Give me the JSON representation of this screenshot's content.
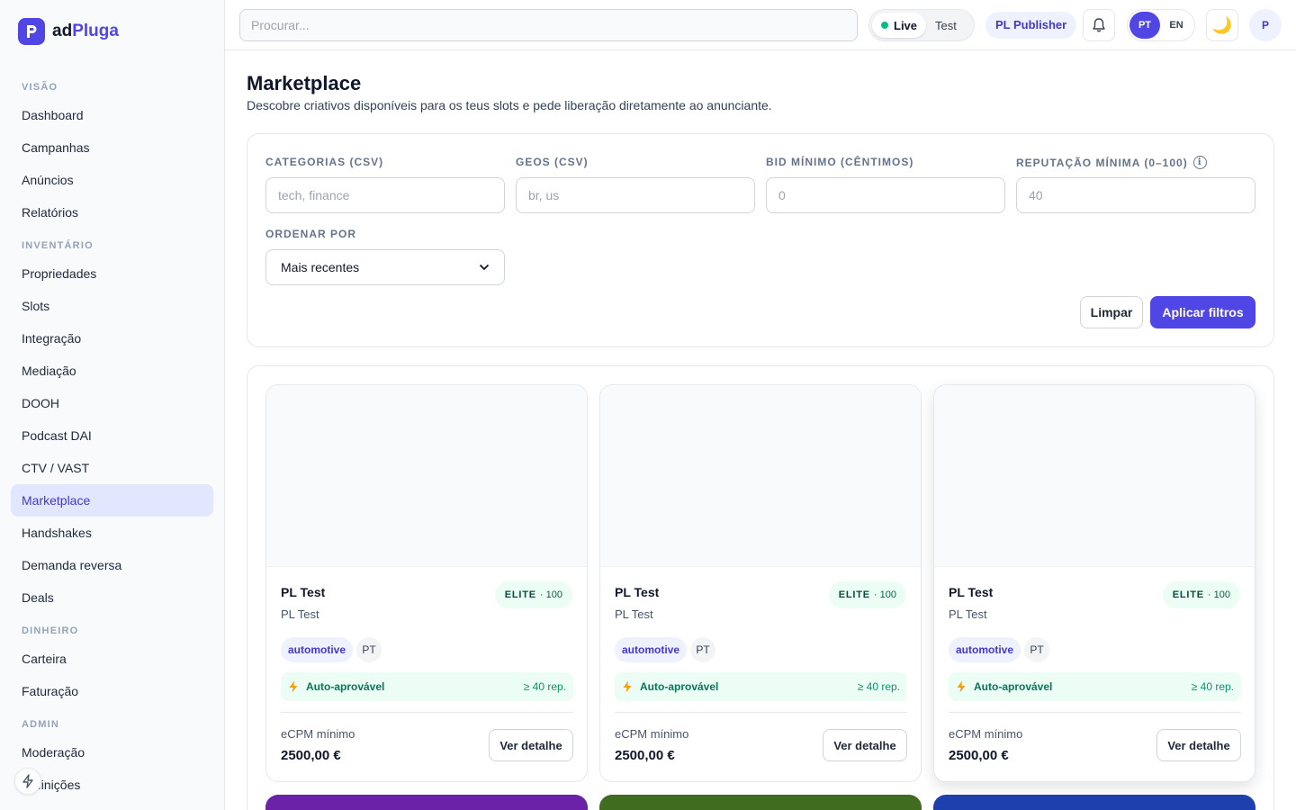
{
  "brand": {
    "prefix": "ad",
    "accent": "Pluga",
    "logo_letter": "P",
    "color": "#4f46e5"
  },
  "sidebar": {
    "sections": [
      {
        "title": "VISÃO",
        "items": [
          {
            "label": "Dashboard"
          },
          {
            "label": "Campanhas"
          },
          {
            "label": "Anúncios"
          },
          {
            "label": "Relatórios"
          }
        ]
      },
      {
        "title": "INVENTÁRIO",
        "items": [
          {
            "label": "Propriedades"
          },
          {
            "label": "Slots"
          },
          {
            "label": "Integração"
          },
          {
            "label": "Mediação"
          },
          {
            "label": "DOOH"
          },
          {
            "label": "Podcast DAI"
          },
          {
            "label": "CTV / VAST"
          },
          {
            "label": "Marketplace",
            "active": true
          },
          {
            "label": "Handshakes"
          },
          {
            "label": "Demanda reversa"
          },
          {
            "label": "Deals"
          }
        ]
      },
      {
        "title": "DINHEIRO",
        "items": [
          {
            "label": "Carteira"
          },
          {
            "label": "Faturação"
          }
        ]
      },
      {
        "title": "ADMIN",
        "items": [
          {
            "label": "Moderação"
          },
          {
            "label": "Definições"
          }
        ]
      }
    ]
  },
  "topbar": {
    "search_placeholder": "Procurar...",
    "mode_live": "Live",
    "mode_test": "Test",
    "publisher": "PL Publisher",
    "lang_pt": "PT",
    "lang_en": "EN",
    "theme_icon": "🌙",
    "avatar_letter": "P"
  },
  "page": {
    "title": "Marketplace",
    "subtitle": "Descobre criativos disponíveis para os teus slots e pede liberação diretamente ao anunciante."
  },
  "filters": {
    "categories": {
      "label": "CATEGORIAS (CSV)",
      "placeholder": "tech, finance"
    },
    "geos": {
      "label": "GEOS (CSV)",
      "placeholder": "br, us"
    },
    "bid_min": {
      "label": "BID MÍNIMO (CÊNTIMOS)",
      "placeholder": "0"
    },
    "reputation": {
      "label": "REPUTAÇÃO MÍNIMA (0–100)",
      "placeholder": "40",
      "info": "i"
    },
    "sort": {
      "label": "ORDENAR POR",
      "value": "Mais recentes"
    },
    "clear_label": "Limpar",
    "apply_label": "Aplicar filtros"
  },
  "cards": [
    {
      "title": "PL Test",
      "subtitle": "PL Test",
      "tier": "ELITE",
      "score": "· 100",
      "category": "automotive",
      "geo": "PT",
      "auto_label": "Auto-aprovável",
      "auto_rep": "≥ 40 rep.",
      "ecpm_label": "eCPM mínimo",
      "ecpm_value": "2500,00 €",
      "detail_label": "Ver detalhe"
    },
    {
      "title": "PL Test",
      "subtitle": "PL Test",
      "tier": "ELITE",
      "score": "· 100",
      "category": "automotive",
      "geo": "PT",
      "auto_label": "Auto-aprovável",
      "auto_rep": "≥ 40 rep.",
      "ecpm_label": "eCPM mínimo",
      "ecpm_value": "2500,00 €",
      "detail_label": "Ver detalhe"
    },
    {
      "title": "PL Test",
      "subtitle": "PL Test",
      "tier": "ELITE",
      "score": "· 100",
      "category": "automotive",
      "geo": "PT",
      "auto_label": "Auto-aprovável",
      "auto_rep": "≥ 40 rep.",
      "ecpm_label": "eCPM mínimo",
      "ecpm_value": "2500,00 €",
      "detail_label": "Ver detalhe"
    }
  ],
  "next_row_colors": [
    "#6b21a8",
    "#3f6c1f",
    "#1e40af"
  ]
}
